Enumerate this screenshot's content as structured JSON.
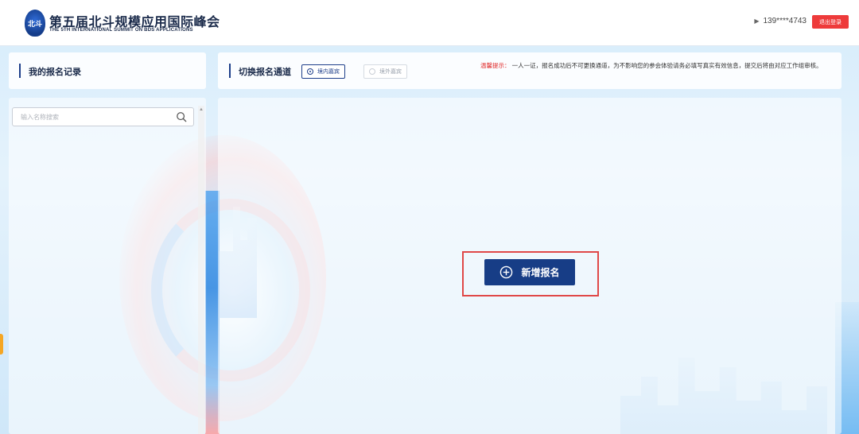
{
  "header": {
    "logo_badge_text": "北斗",
    "title": "第五届北斗规模应用国际峰会",
    "subtitle": "THE 5TH INTERNATIONAL SUMMIT ON BDS APPLICATIONS",
    "user_phone": "139****4743",
    "logout_label": "退出登录"
  },
  "records": {
    "title": "我的报名记录",
    "search_placeholder": "输入名称搜索",
    "search_value": ""
  },
  "channel": {
    "title": "切换报名通道",
    "options": [
      {
        "label": "境内嘉宾",
        "selected": true
      },
      {
        "label": "境外嘉宾",
        "selected": false
      }
    ],
    "notice_label": "温馨提示：",
    "notice_text": "一人一证，报名成功后不可更换通道，为不影响您的参会体验请务必填写真实有效信息，提交后将由对应工作组审核。"
  },
  "main": {
    "add_button_label": "新增报名"
  },
  "colors": {
    "brand_navy": "#173d86",
    "logout_red": "#ee3b3b",
    "notice_red": "#e02a2a",
    "highlight_red": "#e04848"
  }
}
